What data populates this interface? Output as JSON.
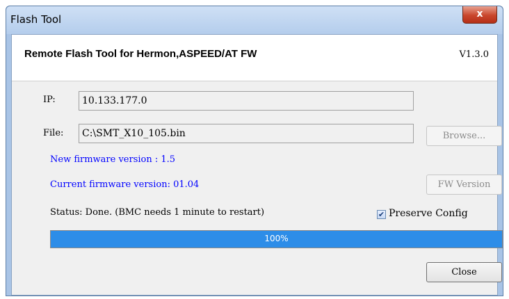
{
  "window": {
    "title": "Flash Tool",
    "close_glyph": "x"
  },
  "header": {
    "app_title": "Remote Flash Tool for Hermon,ASPEED/AT FW",
    "version": "V1.3.0"
  },
  "form": {
    "ip_label": "IP:",
    "ip_value": "10.133.177.0",
    "file_label": "File:",
    "file_value": "C:\\SMT_X10_105.bin",
    "browse_label": "Browse...",
    "new_fw_text": "New firmware version : 1.5",
    "current_fw_text": "Current firmware version: 01.04",
    "fw_version_button": "FW Version",
    "status_text": "Status: Done. (BMC needs 1 minute to restart)",
    "preserve_config_label": "Preserve Config",
    "preserve_config_checked": true
  },
  "progress": {
    "value": 1.0,
    "label": "100%",
    "fill_color": "#2d8de8"
  },
  "footer": {
    "close_label": "Close"
  },
  "colors": {
    "link_text": "#0000ff",
    "title_bar": "#b4cdec",
    "close_button": "#c9462c"
  }
}
